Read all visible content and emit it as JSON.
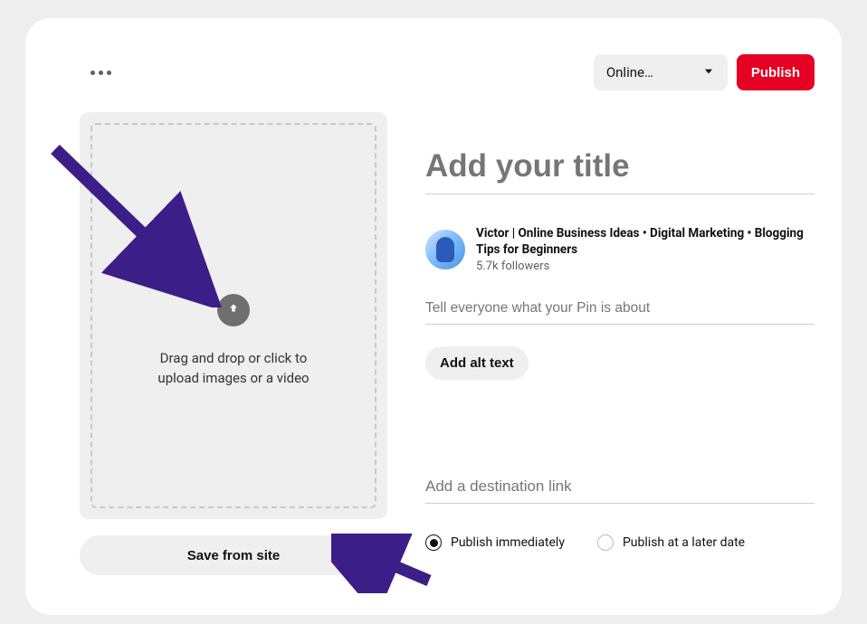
{
  "topbar": {
    "board_selected": "Online…",
    "publish_label": "Publish"
  },
  "upload": {
    "dragdrop_text": "Drag and drop or click to upload images or a video",
    "save_from_site_label": "Save from site"
  },
  "form": {
    "title_placeholder": "Add your title",
    "desc_placeholder": "Tell everyone what your Pin is about",
    "alt_text_label": "Add alt text",
    "dest_link_placeholder": "Add a destination link"
  },
  "author": {
    "name": "Victor | Online Business Ideas • Digital Marketing • Blogging Tips for Beginners",
    "followers": "5.7k followers"
  },
  "schedule": {
    "publish_now": "Publish immediately",
    "publish_later": "Publish at a later date"
  },
  "colors": {
    "accent": "#e60023",
    "annotation_arrow": "#3b1e87"
  }
}
